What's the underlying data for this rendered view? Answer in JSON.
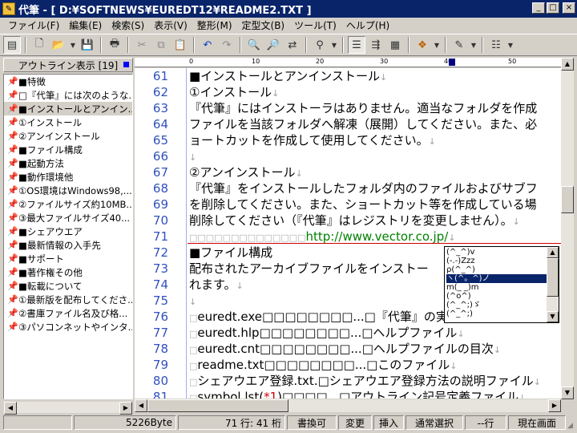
{
  "window": {
    "title": "代筆 - [ D:¥SOFTNEWS¥EUREDT12¥README2.TXT ]",
    "min": "_",
    "max": "□",
    "close": "×"
  },
  "menu": [
    "ファイル(F)",
    "編集(E)",
    "検索(S)",
    "表示(V)",
    "整形(M)",
    "定型文(B)",
    "ツール(T)",
    "ヘルプ(H)"
  ],
  "outline": {
    "header": "アウトライン表示 [19]",
    "items": [
      "■特徴",
      "□『代筆』には次のような...",
      "■インストールとアンイン...",
      "①インストール",
      "②アンインストール",
      "■ファイル構成",
      "■起動方法",
      "■動作環境他",
      "①OS環境はWindows98,...",
      "②ファイルサイズ約10MB...",
      "③最大ファイルサイズ40...",
      "■シェアウエア",
      "■最新情報の入手先",
      "■サポート",
      "■著作権その他",
      "■転載について",
      "①最新版を配布してくださ...",
      "②書庫ファイル名及び格...",
      "③パソコンネットやインタ..."
    ],
    "selected": 2
  },
  "ruler": {
    "ticks": [
      "0",
      "10",
      "20",
      "30",
      "40",
      "50"
    ]
  },
  "editor": {
    "lines": [
      {
        "n": "61",
        "t": "■インストールとアンインストール",
        "ret": "↓"
      },
      {
        "n": "62",
        "t": "①インストール",
        "ret": "↓"
      },
      {
        "n": "63",
        "t": "『代筆』にはインストーラはありません。適当なフォルダを作成",
        "ret": ""
      },
      {
        "n": "64",
        "t": "ファイルを当該フォルダへ解凍（展開）してください。また、必",
        "ret": ""
      },
      {
        "n": "65",
        "t": "ョートカットを作成して使用してください。",
        "ret": "↓"
      },
      {
        "n": "66",
        "t": "",
        "ret": "↓"
      },
      {
        "n": "67",
        "t": "②アンインストール",
        "ret": "↓"
      },
      {
        "n": "68",
        "t": "『代筆』をインストールしたフォルダ内のファイルおよびサブフ",
        "ret": ""
      },
      {
        "n": "69",
        "t": "を削除してください。また、ショートカット等を作成している場",
        "ret": ""
      },
      {
        "n": "70",
        "t": "削除してください（『代筆』はレジストリを変更しません）。",
        "ret": "↓"
      },
      {
        "n": "71",
        "pre": "□□□□□□□□□□□□□□",
        "url": "http://www.vector.co.jp/",
        "ret": "↓"
      },
      {
        "n": "72",
        "t": "■ファイル構成",
        "ret": ""
      },
      {
        "n": "73",
        "t": "配布されたアーカイブファイルをインストー",
        "ret": ""
      },
      {
        "n": "74",
        "t": "れます。",
        "ret": "↓"
      },
      {
        "n": "75",
        "t": "",
        "ret": "↓"
      },
      {
        "n": "76",
        "pre": "□",
        "t": "euredt.exe□□□□□□□□...□『代筆』の実行フ",
        "ret": ""
      },
      {
        "n": "77",
        "pre": "□",
        "t": "euredt.hlp□□□□□□□□...□ヘルプファイル",
        "ret": "↓"
      },
      {
        "n": "78",
        "pre": "□",
        "t": "euredt.cnt□□□□□□□□...□ヘルプファイルの目次",
        "ret": "↓"
      },
      {
        "n": "79",
        "pre": "□",
        "t": "readme.txt□□□□□□□□...□このファイル",
        "ret": "↓"
      },
      {
        "n": "80",
        "pre": "□",
        "t": "シェアウエア登録.txt.□シェアウエア登録方法の説明ファイル",
        "ret": "↓"
      },
      {
        "n": "81",
        "pre": "□",
        "t": "symbol.lst(",
        "red": "*1",
        "t2": ")□□□□...□アウトライン記号定義ファイル",
        "ret": "↓"
      }
    ]
  },
  "popup": {
    "items": [
      "(^_^)v",
      "(-.-)Zzz",
      "ρ(^_^)",
      "ヽ(^。^)ノ",
      "m(_ _)m",
      "(^o^)",
      "(^_^;)ゞ",
      "(^_^;)"
    ],
    "selected": 3
  },
  "status": {
    "size": "5226Byte",
    "pos": "71 行: 41 桁",
    "mode": "書換可",
    "changed": "変更",
    "insert": "挿入",
    "select": "通常選択",
    "row": "--行",
    "view": "現在画面"
  }
}
